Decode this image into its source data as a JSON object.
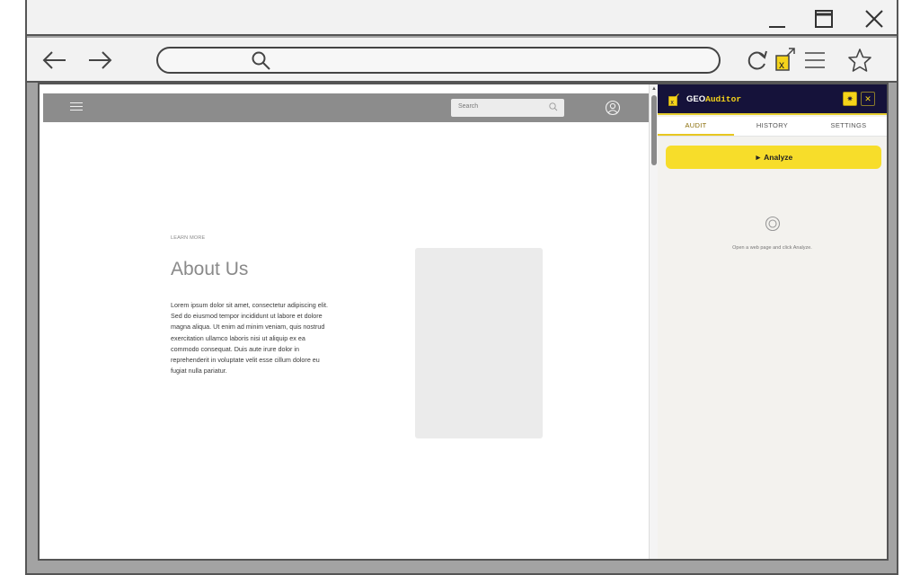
{
  "browser": {
    "url": "",
    "icons": {
      "minimize": "minimize-icon",
      "maximize": "maximize-icon",
      "close": "close-icon",
      "back": "arrow-left-icon",
      "forward": "arrow-right-icon",
      "search": "search-icon",
      "reload": "reload-icon",
      "extension": "geo-auditor-extension-icon",
      "menu": "hamburger-menu-icon",
      "bookmark": "star-icon"
    }
  },
  "site": {
    "search_placeholder": "Search",
    "eyebrow": "LEARN MORE",
    "title": "About Us",
    "body": "Lorem ipsum dolor sit amet, consectetur adipiscing elit. Sed do eiusmod tempor incididunt ut labore et dolore magna aliqua. Ut enim ad minim veniam, quis nostrud exercitation ullamco laboris nisi ut aliquip ex ea commodo consequat. Duis aute irure dolor in reprehenderit in voluptate velit esse cillum dolore eu fugiat nulla pariatur."
  },
  "extension": {
    "brand_prefix": "GEO",
    "brand_suffix": "Auditor",
    "tabs": [
      "AUDIT",
      "HISTORY",
      "SETTINGS"
    ],
    "active_tab": "AUDIT",
    "analyze_label": "► Analyze",
    "empty_message": "Open a web page and click Analyze.",
    "colors": {
      "header": "#15123a",
      "accent": "#f7dd2a"
    }
  }
}
